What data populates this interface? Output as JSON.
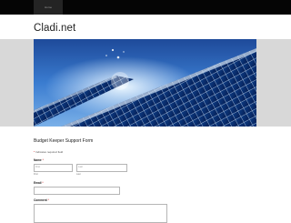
{
  "nav": {
    "tab": "Home"
  },
  "site": {
    "title": "Cladi.net"
  },
  "form": {
    "title": "Budget Keeper Support Form",
    "required_note": "Indicates required field",
    "name_label": "Name",
    "first_value": "First",
    "first_sublabel": "First",
    "last_value": "Last",
    "last_sublabel": "Last",
    "email_label": "Email",
    "comment_label": "Comment"
  },
  "colors": {
    "topbar": "#050505",
    "banner_band": "#d8d8d8",
    "required": "#cc0000"
  },
  "icons": {
    "banner": "solar-panels-image"
  }
}
